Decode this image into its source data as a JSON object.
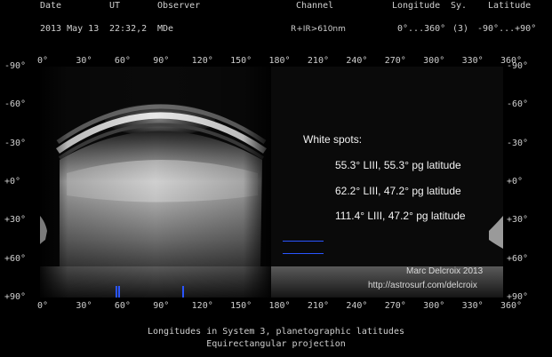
{
  "header": {
    "labels": {
      "date": "Date",
      "ut": "UT",
      "observer": "Observer",
      "channel": "Channel",
      "longitude": "Longitude",
      "sy": "Sy.",
      "latitude": "Latitude"
    },
    "values": {
      "date": "2013 May 13",
      "ut": "22:32,2",
      "observer": "MDe",
      "channel": "R+IR>610nm",
      "longitude": "0°...360°",
      "sy": "(3)",
      "latitude": "-90°...+90°"
    }
  },
  "axes": {
    "longitude_ticks": [
      "0°",
      "30°",
      "60°",
      "90°",
      "120°",
      "150°",
      "180°",
      "210°",
      "240°",
      "270°",
      "300°",
      "330°",
      "360°"
    ],
    "latitude_ticks": [
      "-90°",
      "-60°",
      "-30°",
      "+0°",
      "+30°",
      "+60°",
      "+90°"
    ]
  },
  "annotation": {
    "title": "White spots:",
    "spots": [
      "55.3° LIII, 55.3° pg latitude",
      "62.2° LIII, 47.2° pg latitude",
      "111.4° LIII, 47.2° pg latitude"
    ]
  },
  "credit": {
    "author": "Marc Delcroix 2013",
    "url": "http://astrosurf.com/delcroix"
  },
  "footer": {
    "line1": "Longitudes in System 3, planetographic latitudes",
    "line2": "Equirectangular projection"
  },
  "colors": {
    "background": "#000000",
    "marker": "#2a55ff",
    "text": "#cfcfcf"
  }
}
